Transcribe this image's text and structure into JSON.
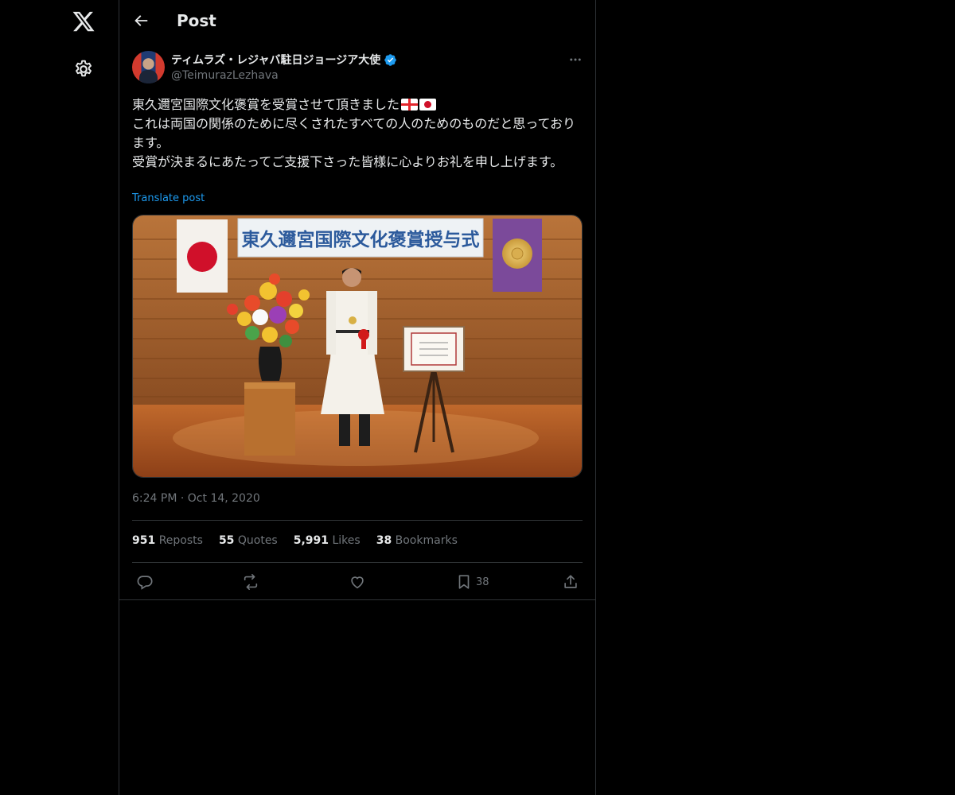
{
  "header": {
    "title": "Post"
  },
  "author": {
    "display_name": "ティムラズ・レジャバ駐日ジョージア大使",
    "handle": "@TeimurazLezhava",
    "verified": true
  },
  "post": {
    "lines": [
      "東久邇宮国際文化褒賞を受賞させて頂きました",
      "これは両国の関係のために尽くされたすべての人のためのものだと思っております。",
      "受賞が決まるにあたってご支援下さった皆様に心よりお礼を申し上げます。"
    ],
    "flags": [
      "georgia-flag",
      "japan-flag"
    ],
    "translate_label": "Translate post",
    "image": {
      "banner_text": "東久邇宮国際文化褒賞授与式"
    },
    "time": "6:24 PM",
    "separator": "·",
    "date": "Oct 14, 2020"
  },
  "stats": {
    "reposts": {
      "count": "951",
      "label": "Reposts"
    },
    "quotes": {
      "count": "55",
      "label": "Quotes"
    },
    "likes": {
      "count": "5,991",
      "label": "Likes"
    },
    "bookmarks": {
      "count": "38",
      "label": "Bookmarks"
    }
  },
  "actions": {
    "bookmark_count": "38"
  },
  "colors": {
    "background": "#000000",
    "text": "#e7e9ea",
    "muted": "#71767b",
    "link": "#1d9bf0",
    "border": "#2f3336"
  }
}
